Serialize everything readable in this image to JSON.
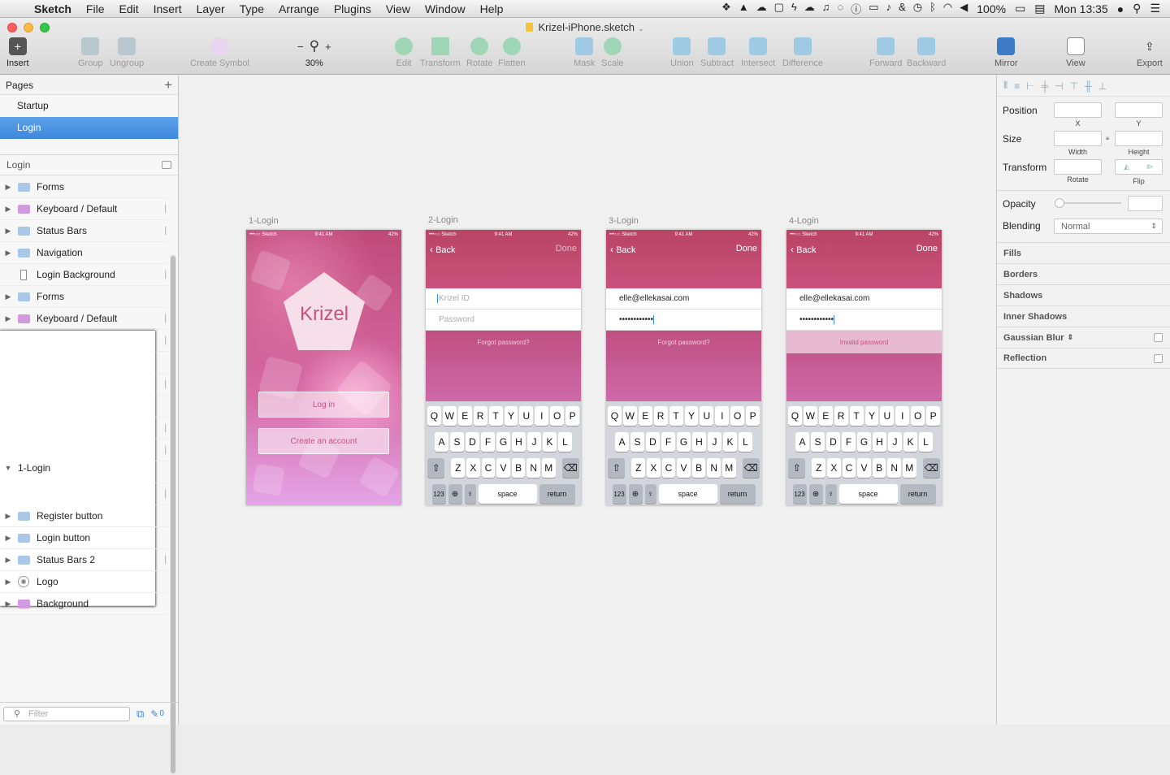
{
  "menubar": {
    "app": "Sketch",
    "items": [
      "File",
      "Edit",
      "Insert",
      "Layer",
      "Type",
      "Arrange",
      "Plugins",
      "View",
      "Window",
      "Help"
    ],
    "battery": "100%",
    "clock": "Mon 13:35"
  },
  "window": {
    "title": "Krizel-iPhone.sketch",
    "toolbar": {
      "insert": "Insert",
      "group": "Group",
      "ungroup": "Ungroup",
      "create_symbol": "Create Symbol",
      "zoom_minus": "−",
      "zoom_plus": "+",
      "zoom": "30%",
      "edit": "Edit",
      "transform": "Transform",
      "rotate": "Rotate",
      "flatten": "Flatten",
      "mask": "Mask",
      "scale": "Scale",
      "union": "Union",
      "subtract": "Subtract",
      "intersect": "Intersect",
      "difference": "Difference",
      "forward": "Forward",
      "backward": "Backward",
      "mirror": "Mirror",
      "view": "View",
      "export": "Export"
    }
  },
  "pages": {
    "header": "Pages",
    "add": "+",
    "items": [
      "Startup",
      "Login"
    ]
  },
  "layers": {
    "header": "Login",
    "groups": [
      {
        "name": "4-Login",
        "children": [
          {
            "name": "Forms",
            "color": "#a9c8e8"
          },
          {
            "name": "Keyboard / Default",
            "color": "#d29be0"
          },
          {
            "name": "Status Bars",
            "color": "#a9c8e8"
          },
          {
            "name": "Navigation",
            "color": "#a9c8e8"
          },
          {
            "name": "Login Background",
            "color": "rect"
          }
        ]
      },
      {
        "name": "3-Login",
        "children": [
          {
            "name": "Forms",
            "color": "#a9c8e8"
          },
          {
            "name": "Keyboard / Default",
            "color": "#d29be0"
          },
          {
            "name": "Status Bars",
            "color": "#a9c8e8"
          },
          {
            "name": "Navigation",
            "color": "#a9c8e8"
          },
          {
            "name": "Login Background",
            "color": "rect"
          }
        ]
      },
      {
        "name": "2-Login",
        "children": [
          {
            "name": "Forms",
            "color": "#a9c8e8"
          },
          {
            "name": "Keyboard / Default",
            "color": "#d29be0"
          },
          {
            "name": "Status Bars",
            "color": "#a9c8e8"
          },
          {
            "name": "Navigation",
            "color": "#d29be0"
          },
          {
            "name": "Login Background",
            "color": "rect"
          }
        ]
      },
      {
        "name": "1-Login",
        "children": [
          {
            "name": "Register button",
            "color": "#a9c8e8"
          },
          {
            "name": "Login button",
            "color": "#a9c8e8"
          },
          {
            "name": "Status Bars 2",
            "color": "#a9c8e8"
          },
          {
            "name": "Logo",
            "color": "symbol"
          },
          {
            "name": "Background",
            "color": "#d29be0"
          }
        ]
      }
    ],
    "filter_placeholder": "Filter",
    "count": "0"
  },
  "artboards": [
    {
      "label": "1-Login",
      "carrier": "•••○○ Sketch",
      "time": "9:41 AM",
      "battery": "42%",
      "logo": "Krizel",
      "login": "Log in",
      "register": "Create an account"
    },
    {
      "label": "2-Login",
      "carrier": "•••○○ Sketch",
      "time": "9:41 AM",
      "battery": "42%",
      "back": "Back",
      "done": "Done",
      "field1": "Krizel ID",
      "field2": "Password",
      "hint": "Forgot password?"
    },
    {
      "label": "3-Login",
      "carrier": "•••○○ Sketch",
      "time": "9:41 AM",
      "battery": "42%",
      "back": "Back",
      "done": "Done",
      "field1": "elle@ellekasai.com",
      "field2": "••••••••••••",
      "hint": "Forgot password?"
    },
    {
      "label": "4-Login",
      "carrier": "•••○○ Sketch",
      "time": "9:41 AM",
      "battery": "42%",
      "back": "Back",
      "done": "Done",
      "field1": "elle@ellekasai.com",
      "field2": "••••••••••••",
      "hint": "Invalid password"
    }
  ],
  "keyboard": {
    "row1": [
      "Q",
      "W",
      "E",
      "R",
      "T",
      "Y",
      "U",
      "I",
      "O",
      "P"
    ],
    "row2": [
      "A",
      "S",
      "D",
      "F",
      "G",
      "H",
      "J",
      "K",
      "L"
    ],
    "row3": [
      "Z",
      "X",
      "C",
      "V",
      "B",
      "N",
      "M"
    ],
    "num": "123",
    "space": "space",
    "return": "return"
  },
  "inspector": {
    "position": "Position",
    "x": "X",
    "y": "Y",
    "size": "Size",
    "width": "Width",
    "height": "Height",
    "transform": "Transform",
    "rotate": "Rotate",
    "flip": "Flip",
    "opacity": "Opacity",
    "blending": "Blending",
    "blending_value": "Normal",
    "sections": [
      "Fills",
      "Borders",
      "Shadows",
      "Inner Shadows",
      "Gaussian Blur",
      "Reflection"
    ]
  }
}
